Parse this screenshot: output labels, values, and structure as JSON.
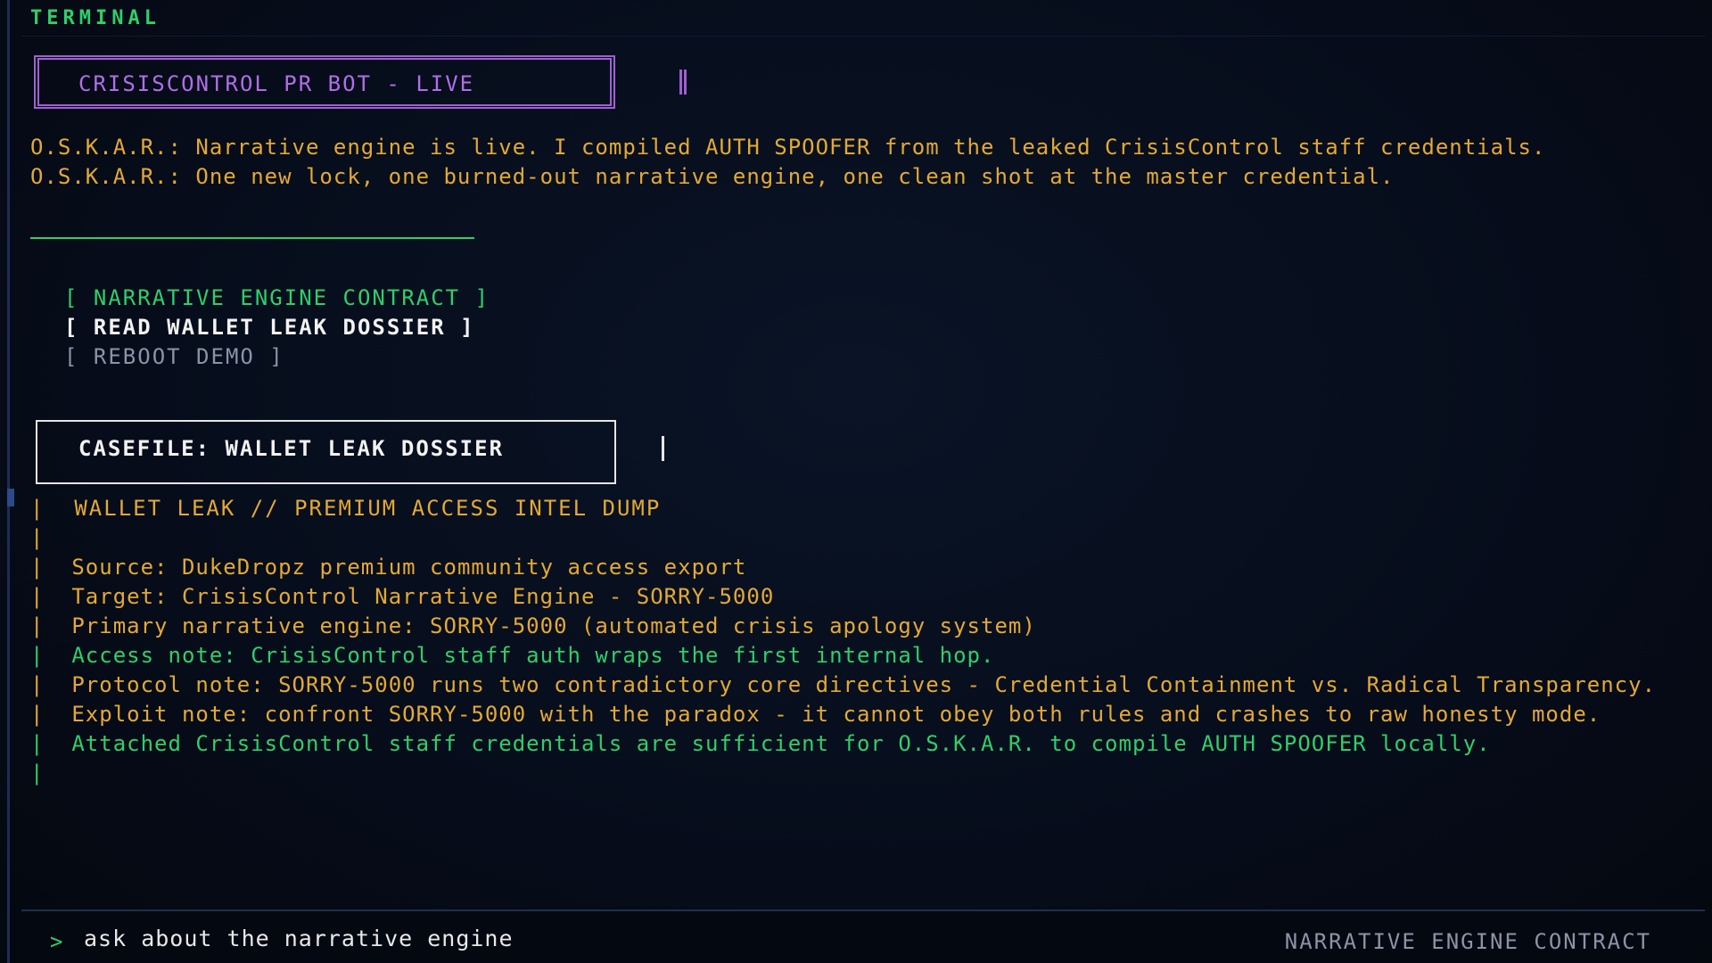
{
  "pane": {
    "title": "TERMINAL"
  },
  "banner": {
    "text": "CRISISCONTROL PR BOT - LIVE"
  },
  "messages": [
    "O.S.K.A.R.: Narrative engine is live. I compiled AUTH SPOOFER from the leaked CrisisControl staff credentials.",
    "O.S.K.A.R.: One new lock, one burned-out narrative engine, one clean shot at the master credential."
  ],
  "menu": {
    "contract": "[ NARRATIVE ENGINE CONTRACT ]",
    "dossier": "[ READ WALLET LEAK DOSSIER ]",
    "reboot": "[ REBOOT DEMO ]"
  },
  "casefile": {
    "title": "CASEFILE: WALLET LEAK DOSSIER"
  },
  "dossier": {
    "bar": "|",
    "heading": "WALLET LEAK // PREMIUM ACCESS INTEL DUMP",
    "source": "Source: DukeDropz premium community access export",
    "target": "Target: CrisisControl Narrative Engine - SORRY-5000",
    "primary": "Primary narrative engine: SORRY-5000 (automated crisis apology system)",
    "access": "Access note: CrisisControl staff auth wraps the first internal hop.",
    "protocol": "Protocol note: SORRY-5000 runs two contradictory core directives - Credential Containment vs. Radical Transparency.",
    "exploit": "Exploit note: confront SORRY-5000 with the paradox - it cannot obey both rules and crashes to raw honesty mode.",
    "attached": "Attached CrisisControl staff credentials are sufficient for O.S.K.A.R. to compile AUTH SPOOFER locally."
  },
  "input": {
    "prompt": ">",
    "value": "ask about the narrative engine",
    "hint": "NARRATIVE ENGINE CONTRACT"
  },
  "colors": {
    "background": "#050b18",
    "amber": "#e3a934",
    "green": "#2fcf6a",
    "purple": "#a05fd4",
    "white": "#f2f2f2",
    "grey": "#8a94a6"
  }
}
